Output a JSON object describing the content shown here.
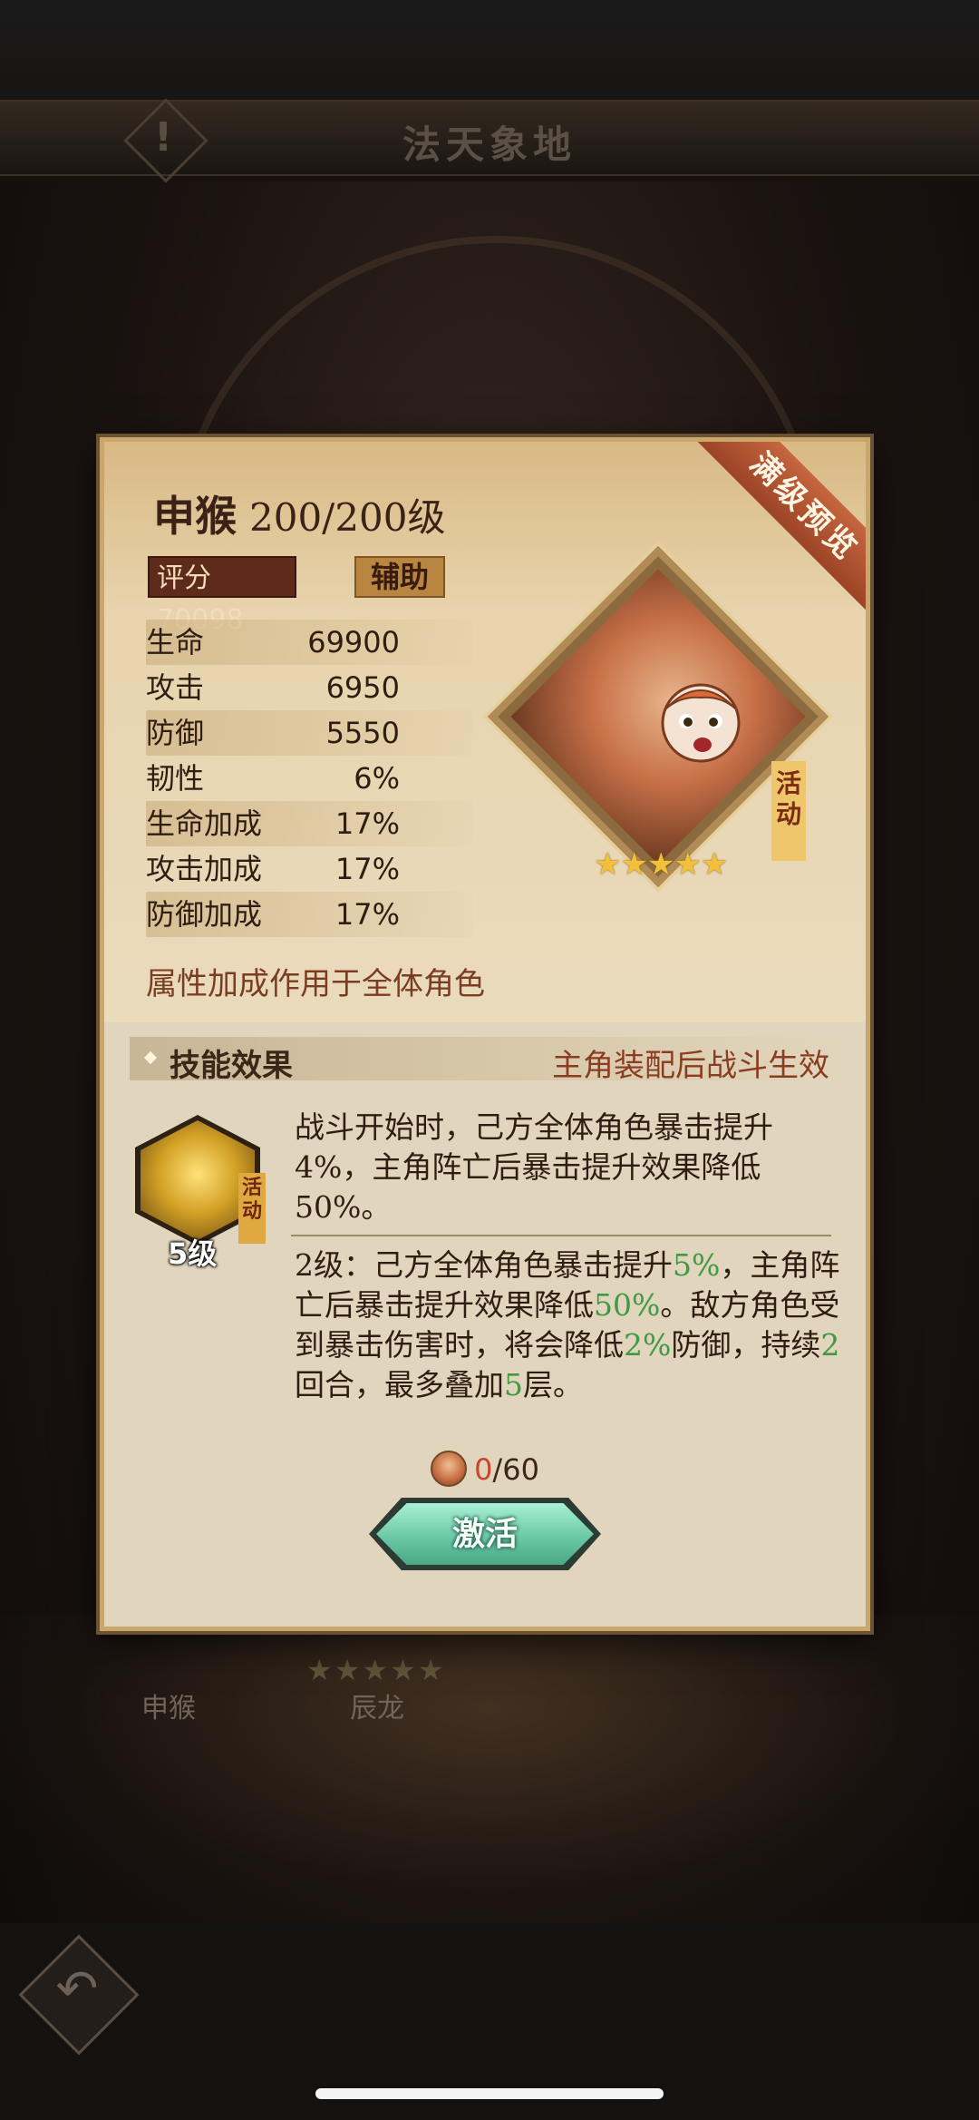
{
  "screen": {
    "title": "法天象地"
  },
  "background": {
    "names": [
      "申猴",
      "辰龙"
    ],
    "stars": "★★★★★"
  },
  "panel": {
    "ribbon": "满级预览",
    "hero_name": "申猴",
    "hero_level": "200/200级",
    "score_label": "评分",
    "score_value": "70098",
    "role": "辅助",
    "stats": [
      {
        "label": "生命",
        "value": "69900"
      },
      {
        "label": "攻击",
        "value": "6950"
      },
      {
        "label": "防御",
        "value": "5550"
      },
      {
        "label": "韧性",
        "value": "6%"
      },
      {
        "label": "生命加成",
        "value": "17%"
      },
      {
        "label": "攻击加成",
        "value": "17%"
      },
      {
        "label": "防御加成",
        "value": "17%"
      }
    ],
    "attr_note": "属性加成作用于全体角色",
    "portrait_tag": "活动",
    "portrait_stars": "★★★★★",
    "skill": {
      "section_title": "技能效果",
      "condition": "主角装配后战斗生效",
      "icon_tag": "活动",
      "level": "5级",
      "description": "战斗开始时，己方全体角色暴击提升4%，主角阵亡后暴击提升效果降低50%。",
      "lvl2_prefix": "2级：己方全体角色暴击提升",
      "lvl2_v1": "5%",
      "lvl2_mid1": "，主角阵亡后暴击提升效果降低",
      "lvl2_v2": "50%",
      "lvl2_mid2": "。敌方角色受到暴击伤害时，将会降低",
      "lvl2_v3": "2%",
      "lvl2_mid3": "防御，持续",
      "lvl2_v4": "2",
      "lvl2_mid4": "回合，最多叠加",
      "lvl2_v5": "5",
      "lvl2_suffix": "层。"
    },
    "cost": {
      "have": "0",
      "need": "/60"
    },
    "activate_label": "激活"
  }
}
